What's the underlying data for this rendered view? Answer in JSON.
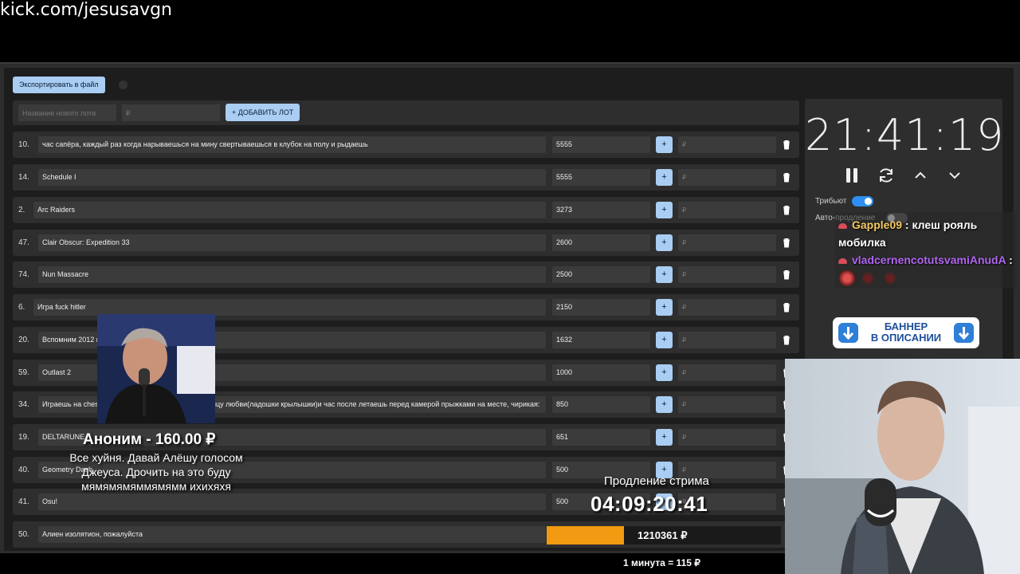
{
  "channel_url": "kick.com/jesusavgn",
  "toolbar": {
    "export_label": "Экспортировать в файл"
  },
  "new_lot": {
    "name_placeholder": "Название нового лота",
    "price_placeholder": "₽",
    "add_label": "+ ДОБАВИТЬ ЛОТ"
  },
  "lots": [
    {
      "num": "10.",
      "name": "час сапёра, каждый раз когда нарываешься на мину свертываешься в клубок на полу и рыдаешь",
      "amount": "5555"
    },
    {
      "num": "14.",
      "name": "Schedule I",
      "amount": "5555"
    },
    {
      "num": "2.",
      "name": "Arc Raiders",
      "amount": "3273"
    },
    {
      "num": "47.",
      "name": "Clair Obscur: Expedition 33",
      "amount": "2600"
    },
    {
      "num": "74.",
      "name": "Nun Massacre",
      "amount": "2500"
    },
    {
      "num": "6.",
      "name": "Игра fuck hitler",
      "amount": "2150"
    },
    {
      "num": "20.",
      "name": "Вспомним 2012 го",
      "amount": "1632"
    },
    {
      "num": "59.",
      "name": "Outlast 2",
      "amount": "1000"
    },
    {
      "num": "34.",
      "name": "Играешь на chess",
      "name_tail": "ицу любви(ладошки крылышки)и час после летаешь перед камерой прыжками на месте, чирикая:",
      "amount": "850"
    },
    {
      "num": "19.",
      "name": "DELTARUNE",
      "amount": "651"
    },
    {
      "num": "40.",
      "name": "Geometry Dash",
      "amount": "500"
    },
    {
      "num": "41.",
      "name": "Osu!",
      "amount": "500"
    },
    {
      "num": "50.",
      "name": "Алиен изолятион, пожалуйста",
      "amount": ""
    }
  ],
  "lot_controls": {
    "plus": "+",
    "currency_placeholder": "₽"
  },
  "timer": {
    "time": "21:41:19"
  },
  "toggles": {
    "tribute_label": "Трибьют",
    "tribute_on": true,
    "auto_label": "Авто-продление",
    "auto_on": false
  },
  "chat": {
    "messages": [
      {
        "user": "Gapple09",
        "user_color": "#f3c860",
        "text": ": клеш рояль мобилка"
      },
      {
        "user": "vladcernencotutsvamiAnudA",
        "user_color": "#b065f0",
        "text": ":"
      }
    ]
  },
  "banner": {
    "line1": "БАННЕР",
    "line2": "В ОПИСАНИИ"
  },
  "donation": {
    "title": "Аноним - 160.00 ₽",
    "message_lines": [
      "Все хуйня. Давай Алёшу голосом",
      "Джеуса. Дрочить на это буду",
      "мямямямяммямямм ихихяхя"
    ]
  },
  "extension": {
    "label": "Продление стрима",
    "time": "04:09:20:41",
    "total": "1210361 ₽",
    "rate": "1 минута = 115 ₽",
    "progress": 0.33
  },
  "colors": {
    "accent": "#a9cdf3",
    "toggle_on": "#2f8ff0",
    "progress": "#f29a12"
  }
}
